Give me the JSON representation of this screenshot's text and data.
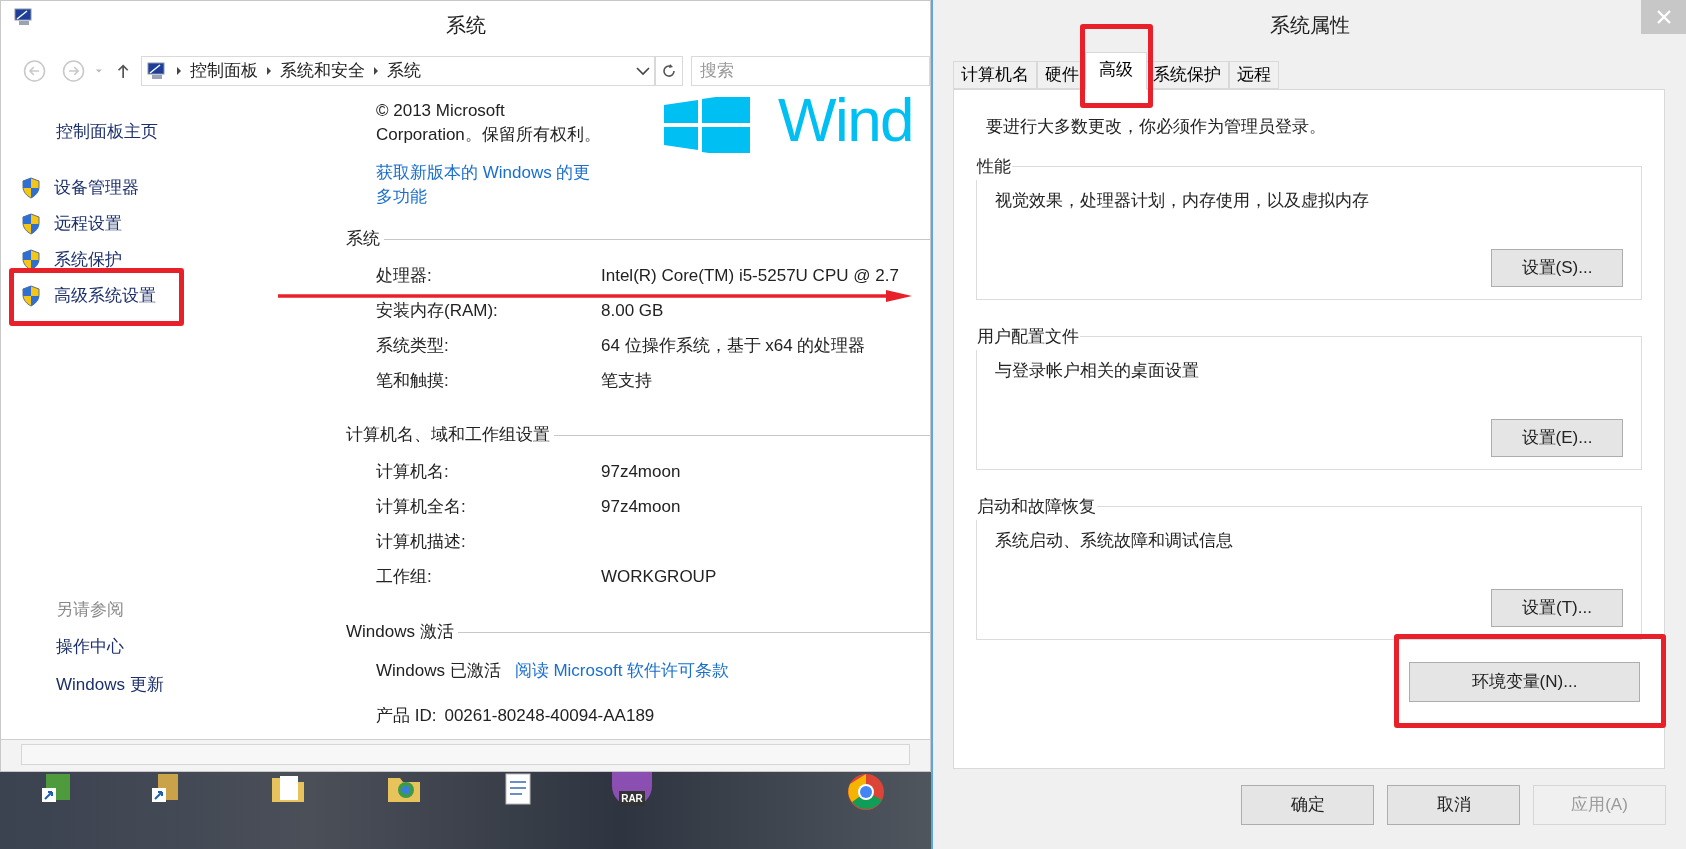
{
  "system_window": {
    "title": "系统",
    "breadcrumb": [
      "控制面板",
      "系统和安全",
      "系统"
    ],
    "search": {
      "placeholder": "搜索"
    },
    "sidebar": {
      "home": "控制面板主页",
      "items": [
        {
          "label": "设备管理器",
          "annotated": false
        },
        {
          "label": "远程设置",
          "annotated": false
        },
        {
          "label": "系统保护",
          "annotated": false
        },
        {
          "label": "高级系统设置",
          "annotated": true
        }
      ],
      "see_also": {
        "heading": "另请参阅",
        "links": [
          "操作中心",
          "Windows 更新"
        ]
      }
    },
    "copyright": "© 2013 Microsoft Corporation。保留所有权利。",
    "upgrade_link": "获取新版本的 Windows 的更多功能",
    "logo_text": "Wind",
    "sections": [
      {
        "title": "系统",
        "rows": [
          {
            "label": "处理器:",
            "value": "Intel(R) Core(TM) i5-5257U CPU @ 2.7"
          },
          {
            "label": "安装内存(RAM):",
            "value": "8.00 GB"
          },
          {
            "label": "系统类型:",
            "value": "64 位操作系统，基于 x64 的处理器"
          },
          {
            "label": "笔和触摸:",
            "value": "笔支持"
          }
        ]
      },
      {
        "title": "计算机名、域和工作组设置",
        "rows": [
          {
            "label": "计算机名:",
            "value": "97z4moon"
          },
          {
            "label": "计算机全名:",
            "value": "97z4moon"
          },
          {
            "label": "计算机描述:",
            "value": ""
          },
          {
            "label": "工作组:",
            "value": "WORKGROUP"
          }
        ]
      }
    ],
    "activation": {
      "title": "Windows 激活",
      "status": "Windows 已激活",
      "license_link": "阅读 Microsoft 软件许可条款",
      "product_id_label": "产品 ID:",
      "product_id": "00261-80248-40094-AA189"
    }
  },
  "properties_dialog": {
    "title": "系统属性",
    "tabs": [
      {
        "label": "计算机名",
        "selected": false,
        "annotated": false
      },
      {
        "label": "硬件",
        "selected": false,
        "annotated": false
      },
      {
        "label": "高级",
        "selected": true,
        "annotated": true
      },
      {
        "label": "系统保护",
        "selected": false,
        "annotated": false
      },
      {
        "label": "远程",
        "selected": false,
        "annotated": false
      }
    ],
    "intro": "要进行大多数更改，你必须作为管理员登录。",
    "groups": [
      {
        "title": "性能",
        "description": "视觉效果，处理器计划，内存使用，以及虚拟内存",
        "button": "设置(S)..."
      },
      {
        "title": "用户配置文件",
        "description": "与登录帐户相关的桌面设置",
        "button": "设置(E)..."
      },
      {
        "title": "启动和故障恢复",
        "description": "系统启动、系统故障和调试信息",
        "button": "设置(T)..."
      }
    ],
    "env_button": {
      "label": "环境变量(N)...",
      "annotated": true
    },
    "buttons": [
      {
        "label": "确定",
        "disabled": false
      },
      {
        "label": "取消",
        "disabled": false
      },
      {
        "label": "应用(A)",
        "disabled": true
      }
    ]
  },
  "desktop": {
    "rar_label": "RAR"
  }
}
